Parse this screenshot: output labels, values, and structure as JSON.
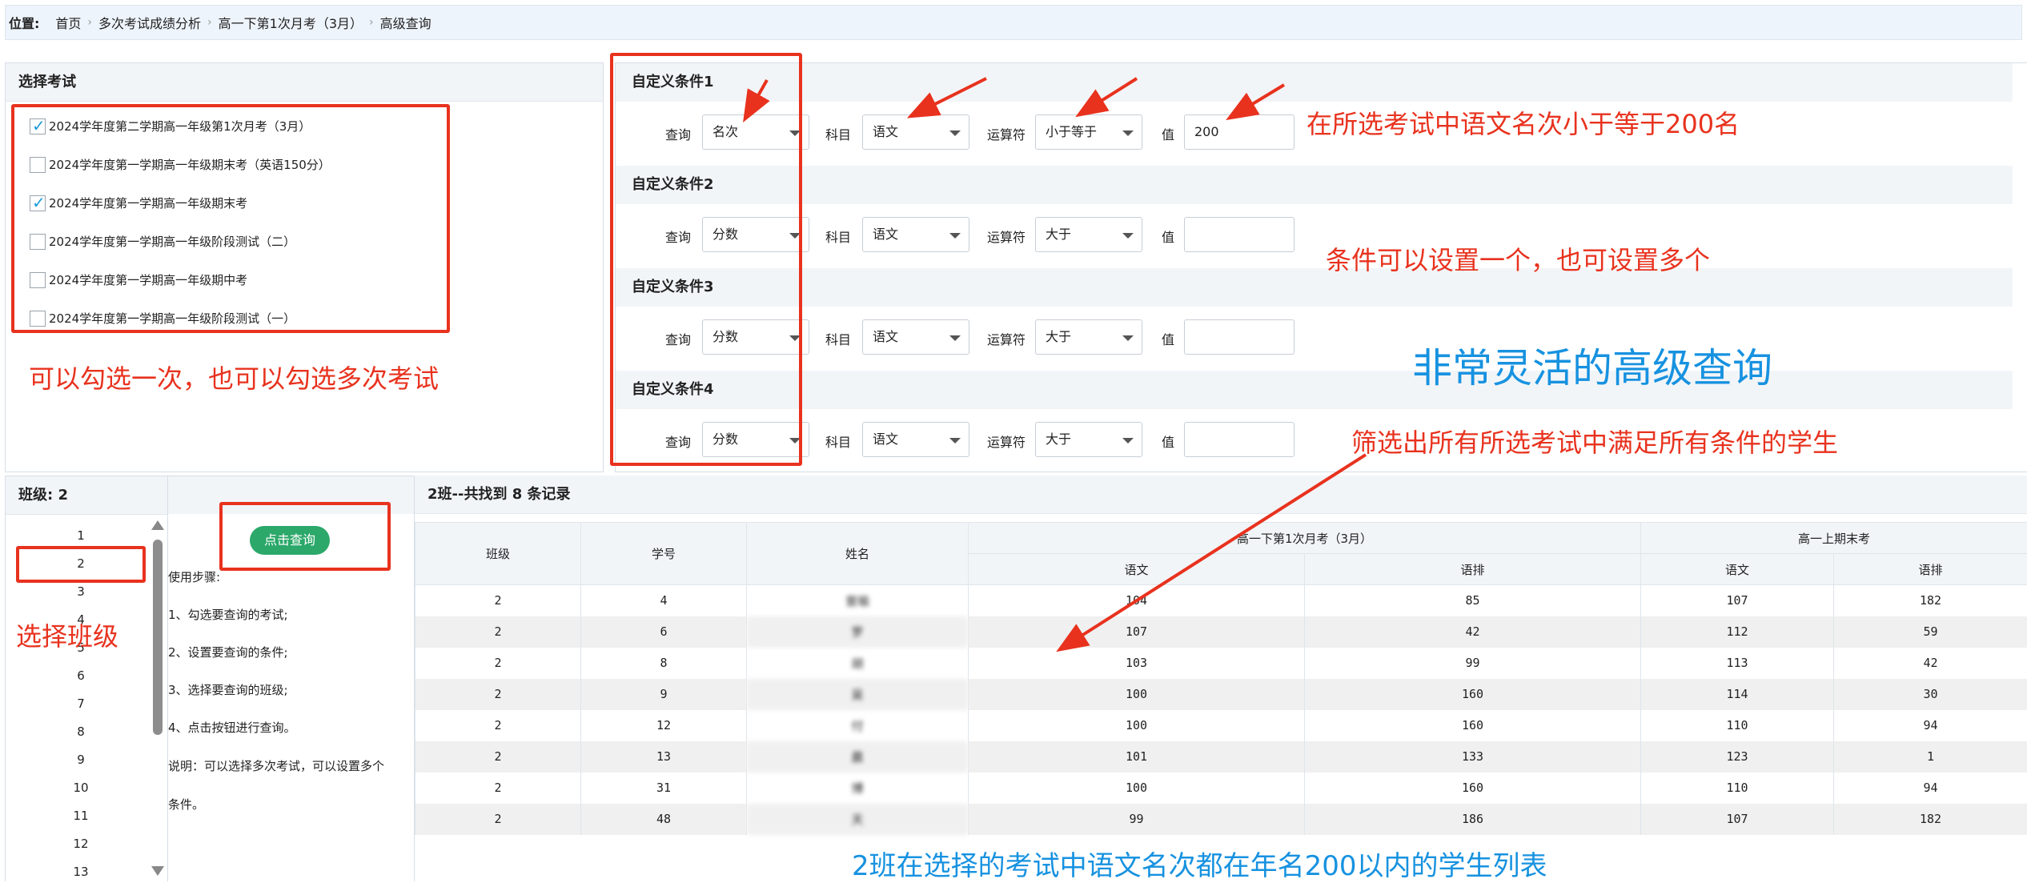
{
  "breadcrumb": {
    "label": "位置:",
    "items": [
      "首页",
      "多次考试成绩分析",
      "高一下第1次月考（3月）",
      "高级查询"
    ]
  },
  "exam_panel": {
    "title": "选择考试",
    "exams": [
      {
        "label": "2024学年度第二学期高一年级第1次月考（3月）",
        "checked": true
      },
      {
        "label": "2024学年度第一学期高一年级期末考（英语150分）",
        "checked": false
      },
      {
        "label": "2024学年度第一学期高一年级期末考",
        "checked": true
      },
      {
        "label": "2024学年度第一学期高一年级阶段测试（二）",
        "checked": false
      },
      {
        "label": "2024学年度第一学期高一年级期中考",
        "checked": false
      },
      {
        "label": "2024学年度第一学期高一年级阶段测试（一）",
        "checked": false
      }
    ]
  },
  "conditions": {
    "field_labels": {
      "query": "查询",
      "subject": "科目",
      "operator": "运算符",
      "value": "值"
    },
    "items": [
      {
        "title": "自定义条件1",
        "query": "名次",
        "subject": "语文",
        "operator": "小于等于",
        "value": "200"
      },
      {
        "title": "自定义条件2",
        "query": "分数",
        "subject": "语文",
        "operator": "大于",
        "value": ""
      },
      {
        "title": "自定义条件3",
        "query": "分数",
        "subject": "语文",
        "operator": "大于",
        "value": ""
      },
      {
        "title": "自定义条件4",
        "query": "分数",
        "subject": "语文",
        "operator": "大于",
        "value": ""
      }
    ]
  },
  "class_panel": {
    "title": "班级: 2",
    "classes": [
      "1",
      "2",
      "3",
      "4",
      "5",
      "6",
      "7",
      "8",
      "9",
      "10",
      "11",
      "12",
      "13"
    ],
    "selected": "2"
  },
  "query_button": {
    "label": "点击查询"
  },
  "instructions": {
    "heading": "使用步骤:",
    "steps": [
      "1、勾选要查询的考试;",
      "2、设置要查询的条件;",
      "3、选择要查询的班级;",
      "4、点击按钮进行查询。"
    ],
    "note_line1": "说明：可以选择多次考试，可以设置多个",
    "note_line2": "条件。"
  },
  "results": {
    "title": "2班--共找到 8 条记录",
    "col_headers": {
      "class": "班级",
      "student_no": "学号",
      "name": "姓名"
    },
    "exam_groups": [
      {
        "name": "高一下第1次月考（3月）",
        "subcols": [
          "语文",
          "语排"
        ]
      },
      {
        "name": "高一上期末考",
        "subcols": [
          "语文",
          "语排"
        ]
      }
    ],
    "rows": [
      {
        "class": "2",
        "no": "4",
        "name": "曾瑜",
        "e1_score": "104",
        "e1_rank": "85",
        "e2_score": "107",
        "e2_rank": "182"
      },
      {
        "class": "2",
        "no": "6",
        "name": "罗",
        "e1_score": "107",
        "e1_rank": "42",
        "e2_score": "112",
        "e2_rank": "59"
      },
      {
        "class": "2",
        "no": "8",
        "name": "胡",
        "e1_score": "103",
        "e1_rank": "99",
        "e2_score": "113",
        "e2_rank": "42"
      },
      {
        "class": "2",
        "no": "9",
        "name": "吴",
        "e1_score": "100",
        "e1_rank": "160",
        "e2_score": "114",
        "e2_rank": "30"
      },
      {
        "class": "2",
        "no": "12",
        "name": "付",
        "e1_score": "100",
        "e1_rank": "160",
        "e2_score": "110",
        "e2_rank": "94"
      },
      {
        "class": "2",
        "no": "13",
        "name": "晨",
        "e1_score": "101",
        "e1_rank": "133",
        "e2_score": "123",
        "e2_rank": "1"
      },
      {
        "class": "2",
        "no": "31",
        "name": "博",
        "e1_score": "100",
        "e1_rank": "160",
        "e2_score": "110",
        "e2_rank": "94"
      },
      {
        "class": "2",
        "no": "48",
        "name": "天",
        "e1_score": "99",
        "e1_rank": "186",
        "e2_score": "107",
        "e2_rank": "182"
      }
    ]
  },
  "annotations": {
    "exam_note": "可以勾选一次，也可以勾选多次考试",
    "cond1_note": "在所选考试中语文名次小于等于200名",
    "multi_cond_note": "条件可以设置一个，也可设置多个",
    "headline": "非常灵活的高级查询",
    "filter_note": "筛选出所有所选考试中满足所有条件的学生",
    "class_note": "选择班级",
    "result_note": "2班在选择的考试中语文名次都在年名200以内的学生列表"
  },
  "colors": {
    "annotation_red": "#e8321e",
    "annotation_blue": "#1792e0",
    "button_green": "#2ca86a",
    "check_blue": "#1a9bd7"
  }
}
